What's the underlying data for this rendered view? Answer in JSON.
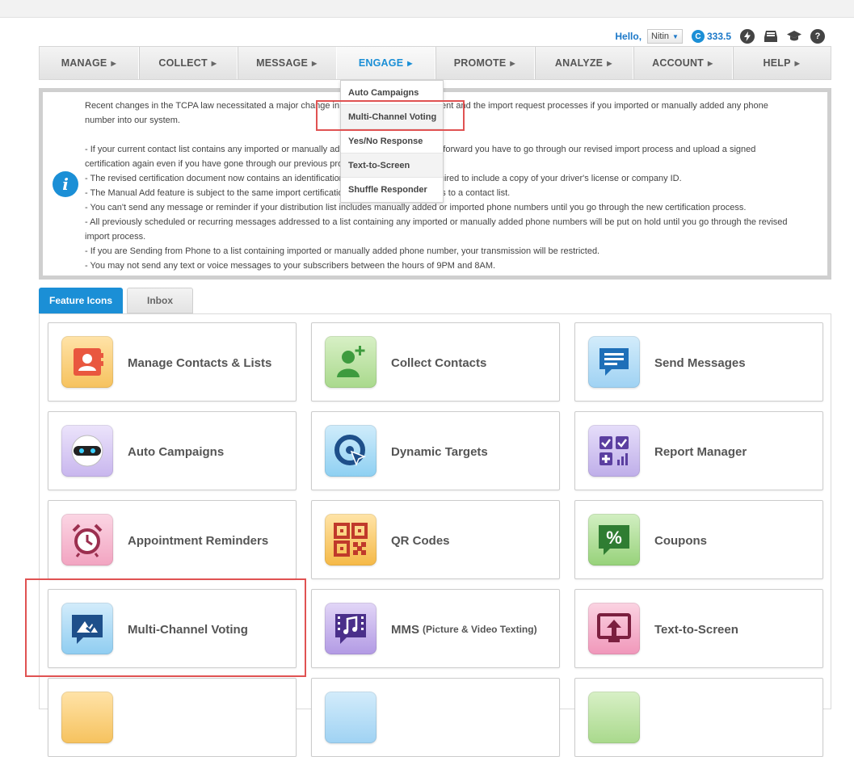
{
  "userbar": {
    "hello": "Hello,",
    "username": "Nitin",
    "credits_badge": "C",
    "credits": "333.5"
  },
  "nav": [
    {
      "label": "MANAGE"
    },
    {
      "label": "COLLECT"
    },
    {
      "label": "MESSAGE"
    },
    {
      "label": "ENGAGE"
    },
    {
      "label": "PROMOTE"
    },
    {
      "label": "ANALYZE"
    },
    {
      "label": "ACCOUNT"
    },
    {
      "label": "HELP"
    }
  ],
  "nav_active": "ENGAGE",
  "dropdown": [
    {
      "label": "Auto Campaigns"
    },
    {
      "label": "Multi-Channel Voting"
    },
    {
      "label": "Yes/No Response"
    },
    {
      "label": "Text-to-Screen"
    },
    {
      "label": "Shuffle Responder"
    }
  ],
  "notice": {
    "lines": [
      "Recent changes in the TCPA law necessitated a major change in our contact list management and the import request processes if you imported or manually added any phone number into our system.",
      "",
      "- If your current contact list contains any imported or manually added phone number, going forward you have to go through our revised import process and upload a signed certification again even if you have gone through our previous process.",
      "- The revised certification document now contains an identification section and you are required to include a copy of your driver's license or company ID.",
      "- The Manual Add feature is subject to the same import certification process to add numbers to a contact list.",
      "- You can't send any message or reminder if your distribution list includes manually added or imported phone numbers until you go through the new certification process.",
      "- All previously scheduled or recurring messages addressed to a list containing any imported or manually added phone numbers will be put on hold until you go through the revised import process.",
      "- If you are Sending from Phone to a list containing imported or manually added phone number, your transmission will be restricted.",
      "- You may not send any text or voice messages to your subscribers between the hours of 9PM and 8AM."
    ]
  },
  "tabs": [
    {
      "label": "Feature Icons"
    },
    {
      "label": "Inbox"
    }
  ],
  "cards": [
    {
      "label": "Manage Contacts & Lists",
      "icon": "contacts-book-icon",
      "color": "#f08a4b"
    },
    {
      "label": "Collect Contacts",
      "icon": "add-contact-icon",
      "color": "#5cb85c"
    },
    {
      "label": "Send Messages",
      "icon": "message-bubble-icon",
      "color": "#2a7fc9"
    },
    {
      "label": "Auto Campaigns",
      "icon": "robot-icon",
      "color": "#b39ddb"
    },
    {
      "label": "Dynamic Targets",
      "icon": "target-cursor-icon",
      "color": "#3aa3e3"
    },
    {
      "label": "Report Manager",
      "icon": "report-grid-icon",
      "color": "#9575cd"
    },
    {
      "label": "Appointment Reminders",
      "icon": "alarm-clock-icon",
      "color": "#ec6f9b"
    },
    {
      "label": "QR Codes",
      "icon": "qr-code-icon",
      "color": "#f5a623"
    },
    {
      "label": "Coupons",
      "icon": "percent-coupon-icon",
      "color": "#5cb85c"
    },
    {
      "label": "Multi-Channel Voting",
      "icon": "voting-chat-icon",
      "color": "#3aa3e3"
    },
    {
      "label": "MMS",
      "label_small": "(Picture & Video Texting)",
      "icon": "music-film-icon",
      "color": "#7e57c2"
    },
    {
      "label": "Text-to-Screen",
      "icon": "screen-upload-icon",
      "color": "#ec6f9b"
    }
  ]
}
